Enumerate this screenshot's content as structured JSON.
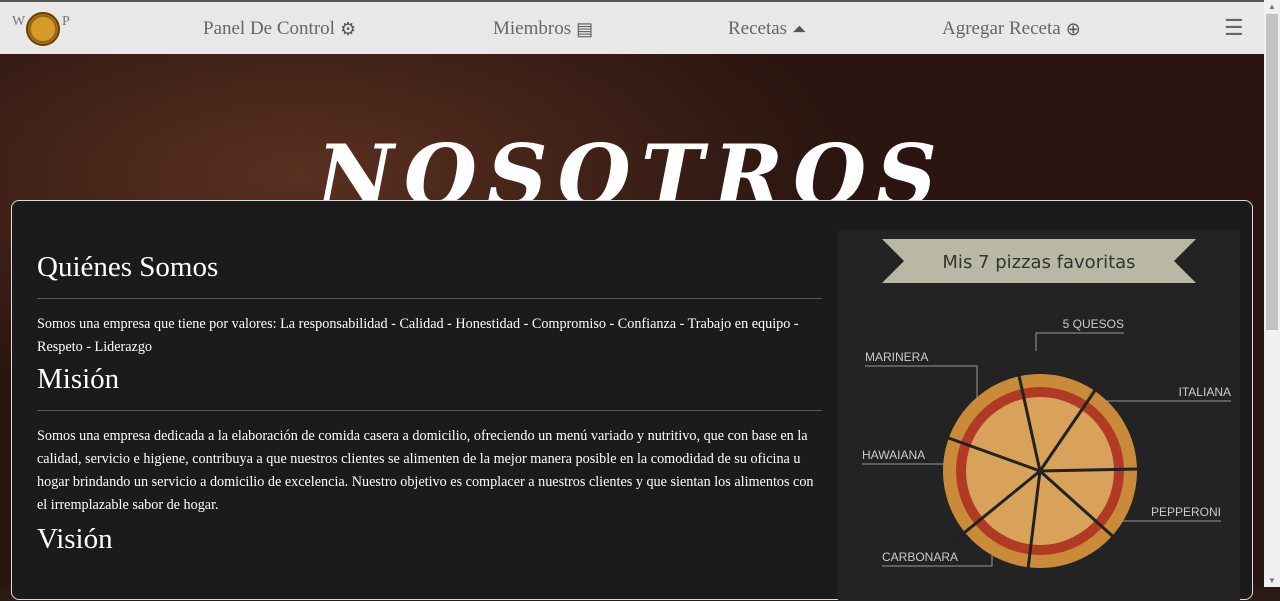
{
  "nav": {
    "logo_left": "W",
    "logo_right": "P",
    "items": [
      {
        "label": "Panel De Control",
        "icon": "gears-icon"
      },
      {
        "label": "Miembros",
        "icon": "id-card-icon"
      },
      {
        "label": "Recetas",
        "icon": "bell-concierge-icon"
      },
      {
        "label": "Agregar Receta",
        "icon": "plus-circle-icon"
      }
    ],
    "menu_icon": "hamburger-icon"
  },
  "hero": {
    "title": "NOSOTROS"
  },
  "about": {
    "h1": "Quiénes Somos",
    "p1": "Somos una empresa que tiene por valores: La responsabilidad -  Calidad - Honestidad - Compromiso - Confianza - Trabajo en equipo - Respeto - Liderazgo",
    "h2": "Misión",
    "p2": "Somos una empresa dedicada a la elaboración de comida casera a domicilio, ofreciendo un menú variado y nutritivo, que con base en la calidad, servicio e higiene, contribuya a que nuestros clientes se alimenten de la mejor manera posible en la comodidad de su oficina u hogar brindando un servicio a domicilio de excelencia. Nuestro objetivo es complacer a nuestros clientes y que sientan los alimentos con el irremplazable sabor de hogar.",
    "h3": "Visión"
  },
  "infographic": {
    "banner": "Mis 7 pizzas favoritas",
    "labels": [
      "5 QUESOS",
      "MARINERA",
      "ITALIANA",
      "HAWAIANA",
      "PEPPERONI",
      "CARBONARA"
    ]
  }
}
